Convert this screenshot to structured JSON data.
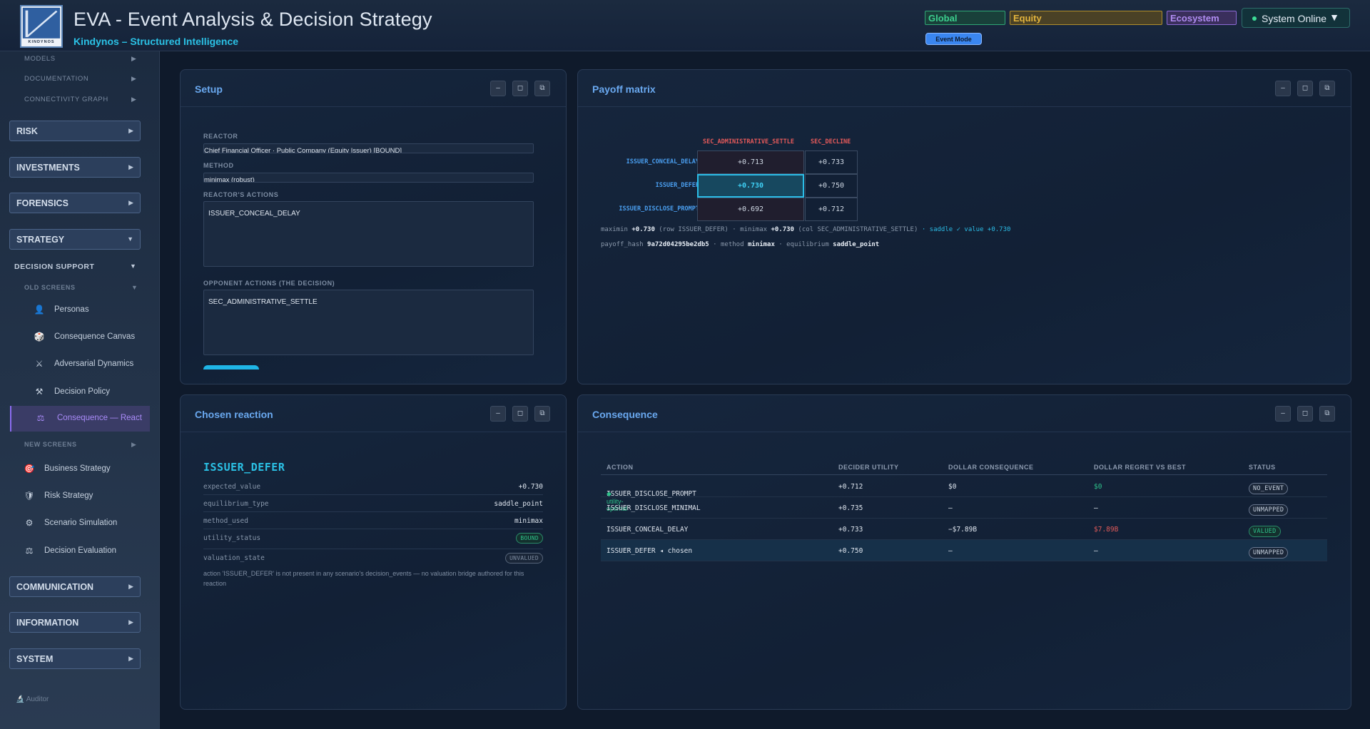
{
  "header": {
    "title": "EVA - Event Analysis & Decision Strategy",
    "subtitle": "Kindynos – Structured Intelligence",
    "logo_text": "KINDYNOS",
    "scopes": {
      "global": "Global",
      "equity": "Equity",
      "ecosystem": "Ecosystem"
    },
    "status": "System Online",
    "event_mode": "Event Mode"
  },
  "sidebar": {
    "top_items": [
      "MODELS",
      "DOCUMENTATION",
      "CONNECTIVITY GRAPH"
    ],
    "groups": {
      "risk": "RISK",
      "investments": "INVESTMENTS",
      "forensics": "FORENSICS",
      "strategy": "STRATEGY",
      "communication": "COMMUNICATION",
      "information": "INFORMATION",
      "system": "SYSTEM"
    },
    "decision_support": "DECISION SUPPORT",
    "old_screens": "OLD SCREENS",
    "new_screens": "NEW SCREENS",
    "old_items": [
      "Personas",
      "Consequence Canvas",
      "Adversarial Dynamics",
      "Decision Policy",
      "Consequence — React"
    ],
    "new_items": [
      "Business Strategy",
      "Risk Strategy",
      "Scenario Simulation",
      "Decision Evaluation"
    ],
    "auditor": "Auditor"
  },
  "setup": {
    "title": "Setup",
    "reactor_label": "REACTOR",
    "reactor_value": "Chief Financial Officer · Public Company (Equity Issuer) [BOUND]",
    "method_label": "METHOD",
    "method_value": "minimax (robust)",
    "actions_label": "REACTOR'S ACTIONS",
    "actions_value": "ISSUER_CONCEAL_DELAY",
    "opponent_label": "OPPONENT ACTIONS (THE DECISION)",
    "opponent_value": "SEC_ADMINISTRATIVE_SETTLE"
  },
  "payoff": {
    "title": "Payoff matrix",
    "cols": [
      "SEC_ADMINISTRATIVE_SETTLE",
      "SEC_DECLINE"
    ],
    "rows": [
      "ISSUER_CONCEAL_DELAY",
      "ISSUER_DEFER",
      "ISSUER_DISCLOSE_PROMPT"
    ],
    "cells": [
      [
        "+0.713",
        "+0.733"
      ],
      [
        "+0.730",
        "+0.750"
      ],
      [
        "+0.692",
        "+0.712"
      ]
    ],
    "summary": {
      "maximin_label": "maximin",
      "maximin_value": "+0.730",
      "maximin_note": "(row ISSUER_DEFER)",
      "minimax_label": "· minimax",
      "minimax_value": "+0.730",
      "minimax_note": "(col SEC_ADMINISTRATIVE_SETTLE)",
      "saddle": "· saddle ✓ value +0.730"
    },
    "hash_line": {
      "hash_label": "payoff_hash",
      "hash_value": "9a72d04295be2db5",
      "method_label": "· method",
      "method_value": "minimax",
      "eq_label": "· equilibrium",
      "eq_value": "saddle_point"
    }
  },
  "chosen": {
    "title": "Chosen reaction",
    "action": "ISSUER_DEFER",
    "rows": [
      {
        "k": "expected_value",
        "v": "+0.730"
      },
      {
        "k": "equilibrium_type",
        "v": "saddle_point"
      },
      {
        "k": "method_used",
        "v": "minimax"
      }
    ],
    "utility_status_label": "utility_status",
    "utility_status": "BOUND",
    "valuation_state_label": "valuation_state",
    "valuation_state": "UNVALUED",
    "note": "action 'ISSUER_DEFER' is not present in any scenario's decision_events — no valuation bridge authored for this reaction"
  },
  "consequence": {
    "title": "Consequence",
    "headers": [
      "ACTION",
      "DECIDER UTILITY",
      "DOLLAR CONSEQUENCE",
      "DOLLAR REGRET VS BEST",
      "STATUS"
    ],
    "rows": [
      {
        "action": "ISSUER_DISCLOSE_PROMPT",
        "tag": "◆ utility-optimal",
        "utility": "+0.712",
        "dollar": "$0",
        "regret": "$0",
        "status": "NO_EVENT"
      },
      {
        "action": "ISSUER_DISCLOSE_MINIMAL",
        "tag": "",
        "utility": "+0.735",
        "dollar": "—",
        "regret": "—",
        "status": "UNMAPPED"
      },
      {
        "action": "ISSUER_CONCEAL_DELAY",
        "tag": "",
        "utility": "+0.733",
        "dollar": "−$7.89B",
        "regret": "$7.89B",
        "status": "VALUED"
      },
      {
        "action": "ISSUER_DEFER ◂ chosen",
        "tag": "",
        "utility": "+0.750",
        "dollar": "—",
        "regret": "—",
        "status": "UNMAPPED"
      }
    ]
  }
}
